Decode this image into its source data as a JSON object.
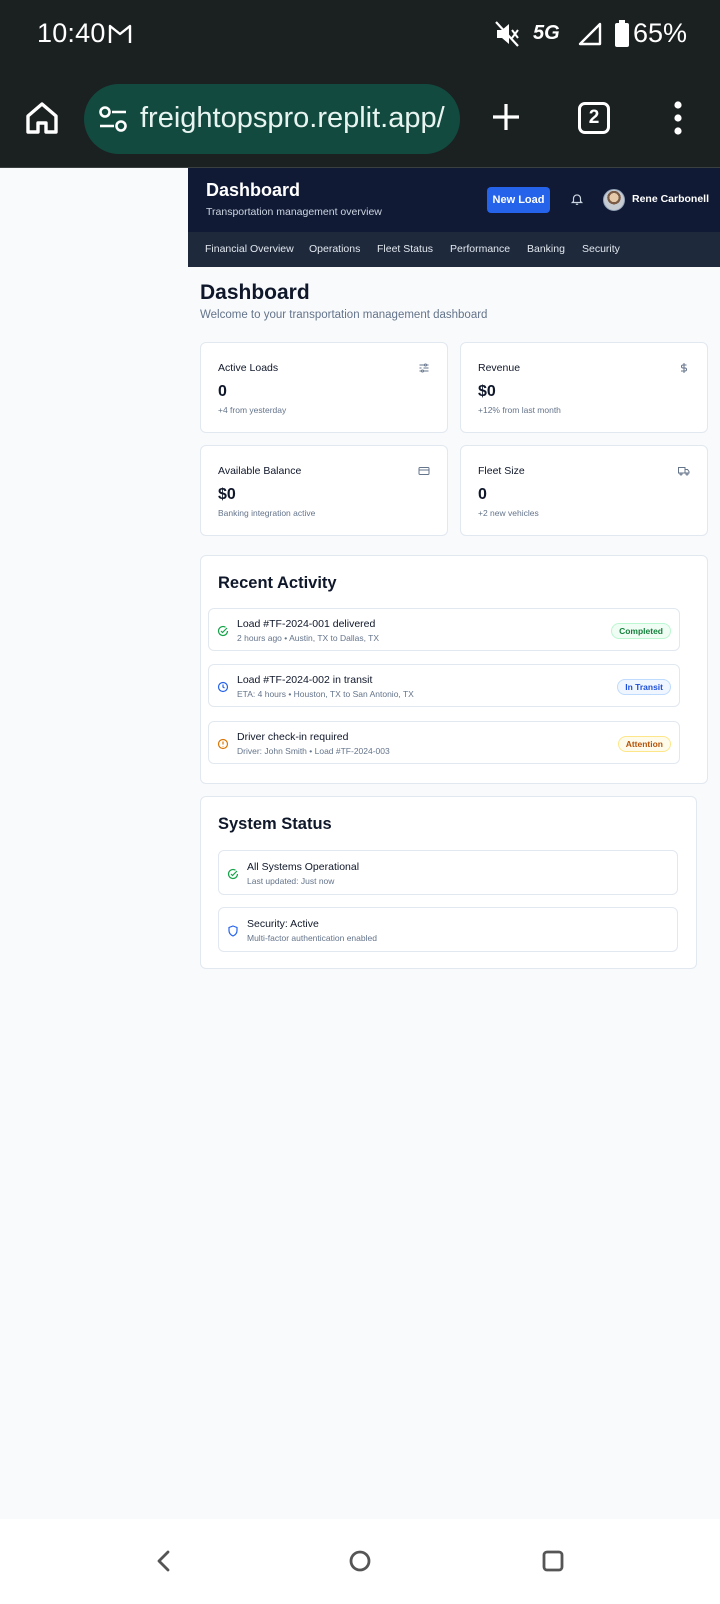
{
  "status_bar": {
    "time": "10:40",
    "network": "5G",
    "battery": "65%"
  },
  "browser": {
    "url": "freightopspro.replit.app/",
    "tab_count": "2"
  },
  "header": {
    "title": "Dashboard",
    "subtitle": "Transportation management overview",
    "new_load_label": "New Load",
    "user_name": "Rene Carbonell"
  },
  "nav": {
    "items": [
      "Financial Overview",
      "Operations",
      "Fleet Status",
      "Performance",
      "Banking",
      "Security"
    ]
  },
  "page": {
    "title": "Dashboard",
    "subtitle": "Welcome to your transportation management dashboard"
  },
  "stats": [
    {
      "label": "Active Loads",
      "value": "0",
      "note": "+4 from yesterday",
      "icon": "sliders-icon"
    },
    {
      "label": "Revenue",
      "value": "$0",
      "note": "+12% from last month",
      "icon": "dollar-icon"
    },
    {
      "label": "Available Balance",
      "value": "$0",
      "note": "Banking integration active",
      "icon": "credit-card-icon"
    },
    {
      "label": "Fleet Size",
      "value": "0",
      "note": "+2 new vehicles",
      "icon": "truck-icon"
    }
  ],
  "recent_activity": {
    "title": "Recent Activity",
    "items": [
      {
        "title": "Load #TF-2024-001 delivered",
        "detail": "2 hours ago • Austin, TX to Dallas, TX",
        "badge": "Completed",
        "icon": "check-circle-icon",
        "color": "#16a34a"
      },
      {
        "title": "Load #TF-2024-002 in transit",
        "detail": "ETA: 4 hours • Houston, TX to San Antonio, TX",
        "badge": "In Transit",
        "icon": "clock-icon",
        "color": "#2563eb"
      },
      {
        "title": "Driver check-in required",
        "detail": "Driver: John Smith • Load #TF-2024-003",
        "badge": "Attention",
        "icon": "alert-circle-icon",
        "color": "#d97706"
      }
    ]
  },
  "system_status": {
    "title": "System Status",
    "items": [
      {
        "title": "All Systems Operational",
        "detail": "Last updated: Just now",
        "icon": "check-circle-icon",
        "color": "#16a34a"
      },
      {
        "title": "Security: Active",
        "detail": "Multi-factor authentication enabled",
        "icon": "shield-icon",
        "color": "#2563eb"
      }
    ]
  },
  "colors": {
    "header_bg": "#111a34",
    "nav_bg": "#1e293b",
    "accent": "#2563eb",
    "url_pill": "#124a40"
  }
}
